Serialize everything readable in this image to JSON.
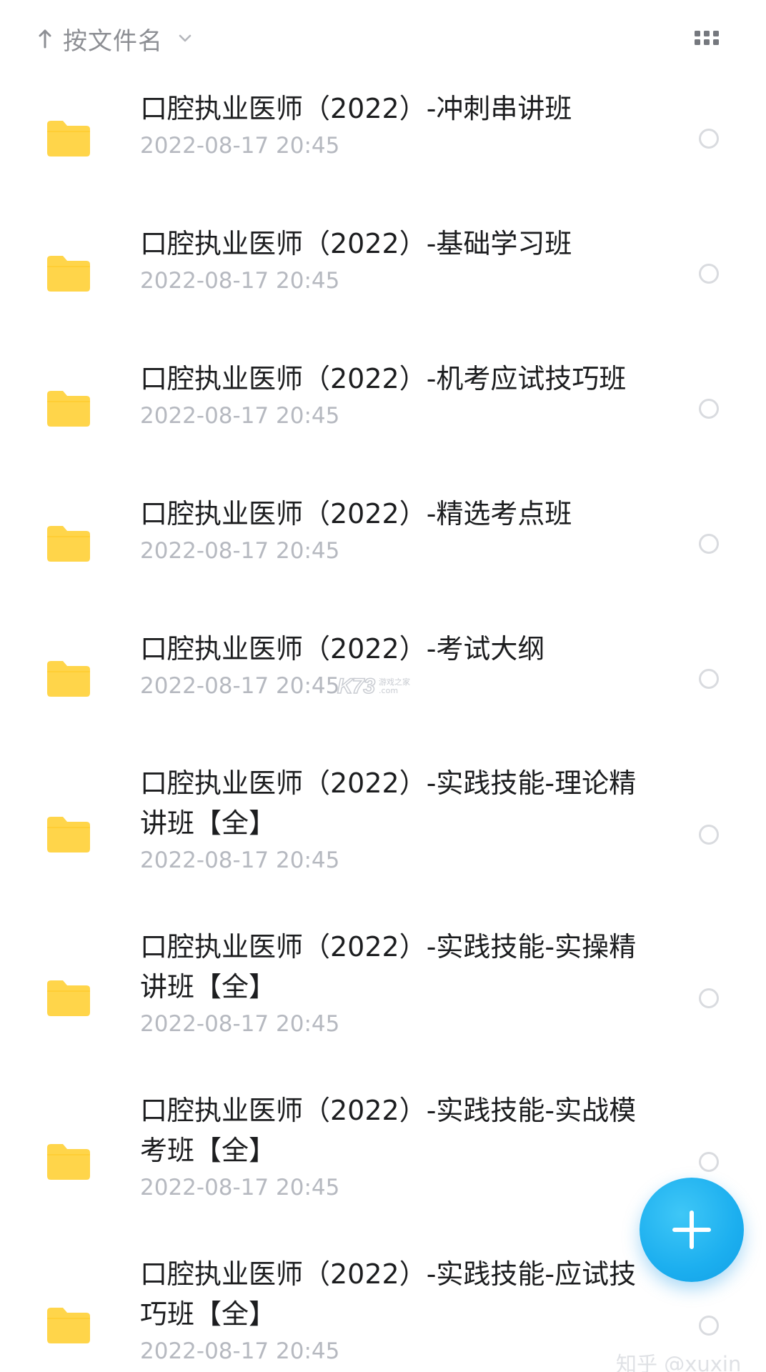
{
  "header": {
    "sort_label": "按文件名",
    "sort_direction_icon": "arrow-up-icon",
    "sort_dropdown_icon": "chevron-down-icon",
    "view_toggle_icon": "grid-view-icon"
  },
  "files": [
    {
      "name": "口腔执业医师（2022）-冲刺串讲班",
      "date": "2022-08-17  20:45"
    },
    {
      "name": "口腔执业医师（2022）-基础学习班",
      "date": "2022-08-17  20:45"
    },
    {
      "name": "口腔执业医师（2022）-机考应试技巧班",
      "date": "2022-08-17  20:45"
    },
    {
      "name": "口腔执业医师（2022）-精选考点班",
      "date": "2022-08-17  20:45"
    },
    {
      "name": "口腔执业医师（2022）-考试大纲",
      "date": "2022-08-17  20:45"
    },
    {
      "name": "口腔执业医师（2022）-实践技能-理论精讲班【全】",
      "date": "2022-08-17  20:45"
    },
    {
      "name": "口腔执业医师（2022）-实践技能-实操精讲班【全】",
      "date": "2022-08-17  20:45"
    },
    {
      "name": "口腔执业医师（2022）-实践技能-实战模考班【全】",
      "date": "2022-08-17  20:45"
    },
    {
      "name": "口腔执业医师（2022）-实践技能-应试技巧班【全】",
      "date": "2022-08-17  20:45"
    }
  ],
  "fab": {
    "icon": "plus-icon"
  },
  "watermarks": {
    "k73_logo": "K73",
    "k73_sub_line1": "游戏之家",
    "k73_sub_line2": ".com",
    "zhihu": "知乎 @xuxin"
  },
  "colors": {
    "folder": "#ffd54a",
    "fab": "#1cafef",
    "title_text": "#1c1d1f",
    "date_text": "#b6b9c0"
  }
}
